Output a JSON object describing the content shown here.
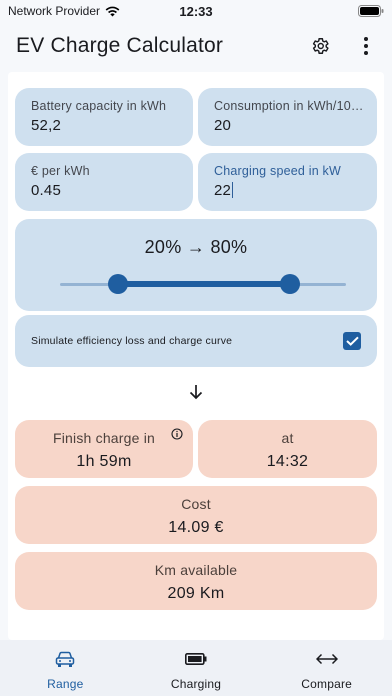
{
  "status_bar": {
    "carrier": "Network Provider",
    "time": "12:33"
  },
  "app_bar": {
    "title": "EV Charge Calculator",
    "settings_icon": "gear-icon",
    "menu_icon": "more-vert-icon"
  },
  "inputs": {
    "battery": {
      "label": "Battery capacity in kWh",
      "value": "52,2"
    },
    "consumption": {
      "label": "Consumption in kWh/10…",
      "value": "20"
    },
    "price": {
      "label": "€ per kWh",
      "value": "0.45"
    },
    "speed": {
      "label": "Charging speed in kW",
      "value": "22"
    }
  },
  "range": {
    "text": "20% → 80%",
    "start_percent": 20,
    "end_percent": 80
  },
  "simulate": {
    "label": "Simulate efficiency loss and charge curve",
    "checked": true
  },
  "results": {
    "finish": {
      "label": "Finish charge in",
      "value": "1h 59m",
      "icon": "info-icon"
    },
    "at": {
      "label": "at",
      "value": "14:32"
    },
    "cost": {
      "label": "Cost",
      "value": "14.09 €"
    },
    "km": {
      "label": "Km available",
      "value": "209 Km"
    }
  },
  "nav": {
    "range": {
      "label": "Range",
      "icon": "car-icon",
      "active": true
    },
    "charging": {
      "label": "Charging",
      "icon": "battery-icon",
      "active": false
    },
    "compare": {
      "label": "Compare",
      "icon": "compare-arrows-icon",
      "active": false
    }
  },
  "colors": {
    "accent": "#1f5ea0",
    "input_bg": "#cfe0ef",
    "result_bg": "#f7d6c9"
  }
}
